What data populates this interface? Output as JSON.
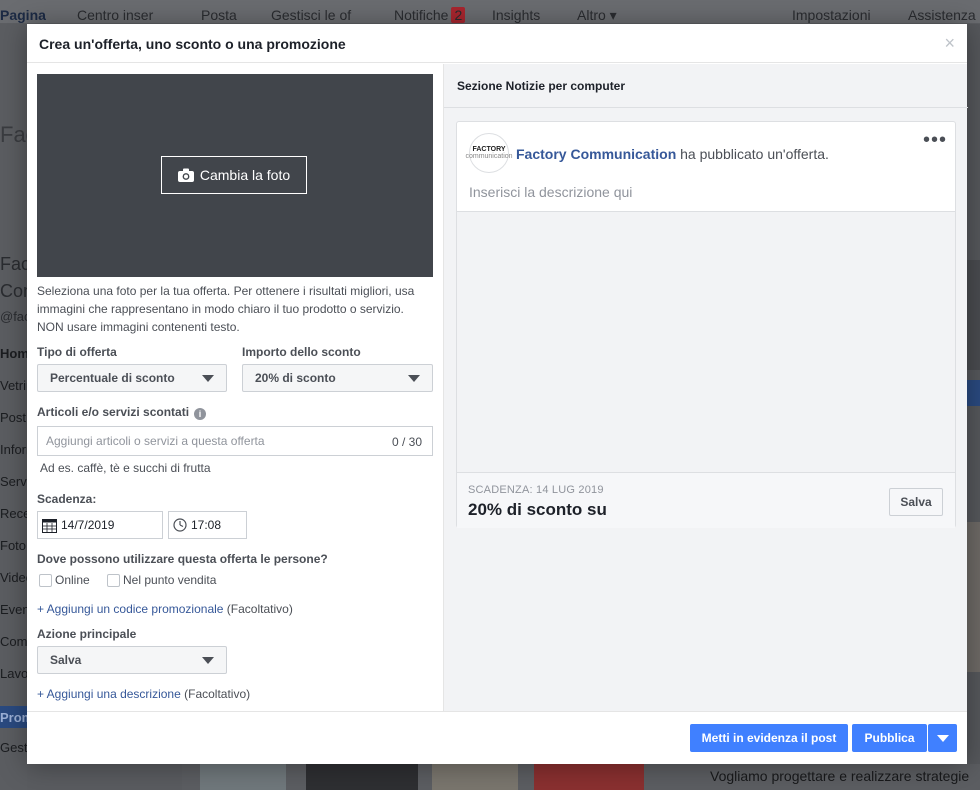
{
  "background": {
    "topnav": [
      "Pagina",
      "Centro inser",
      "Posta",
      "Gestisci le of",
      "Notifiche",
      "Insights",
      "Altro ▾",
      "Impostazioni",
      "Assistenza"
    ],
    "notifications_badge": "2",
    "left_items": [
      "Fact",
      "Com",
      "@fact",
      "Home",
      "Vetrin",
      "Post",
      "Inform",
      "Servi",
      "Rece",
      "Foto",
      "Video",
      "Even",
      "Comu",
      "Lavor",
      "Prom",
      "Gesti"
    ],
    "bottom_text": "Vogliamo progettare e realizzare strategie"
  },
  "modal": {
    "title": "Crea un'offerta, uno sconto o una promozione",
    "close": "×"
  },
  "form": {
    "change_photo": "Cambia la foto",
    "photo_help": "Seleziona una foto per la tua offerta. Per ottenere i risultati migliori, usa immagini che rappresentano in modo chiaro il tuo prodotto o servizio. NON usare immagini contenenti testo.",
    "offer_type_label": "Tipo di offerta",
    "offer_type_value": "Percentuale di sconto",
    "discount_amount_label": "Importo dello sconto",
    "discount_amount_value": "20% di sconto",
    "items_label": "Articoli e/o servizi scontati",
    "items_placeholder": "Aggiungi articoli o servizi a questa offerta",
    "items_counter": "0 / 30",
    "items_hint": "Ad es. caffè, tè e succhi di frutta",
    "expiry_label": "Scadenza:",
    "expiry_date": "14/7/2019",
    "expiry_time": "17:08",
    "where_label": "Dove possono utilizzare questa offerta le persone?",
    "online_label": "Online",
    "in_store_label": "Nel punto vendita",
    "promo_code_link": "+ Aggiungi un codice promozionale",
    "promo_code_optional": " (Facoltativo)",
    "main_action_label": "Azione principale",
    "main_action_value": "Salva",
    "description_link": "+ Aggiungi una descrizione",
    "description_optional": " (Facoltativo)"
  },
  "preview": {
    "section_title": "Sezione Notizie per computer",
    "avatar_line1": "FACTORY",
    "avatar_line2": "communication",
    "page_name": "Factory Communication",
    "headline_rest": " ha pubblicato un'offerta.",
    "more": "•••",
    "description_placeholder": "Inserisci la descrizione qui",
    "expiry": "SCADENZA: 14 LUG 2019",
    "offer_title": "20% di sconto su",
    "save_button": "Salva"
  },
  "footer": {
    "boost_button": "Metti in evidenza il post",
    "publish_button": "Pubblica"
  },
  "colors": {
    "accent": "#4080ff",
    "link": "#365899",
    "photo_bg": "#41454b"
  }
}
